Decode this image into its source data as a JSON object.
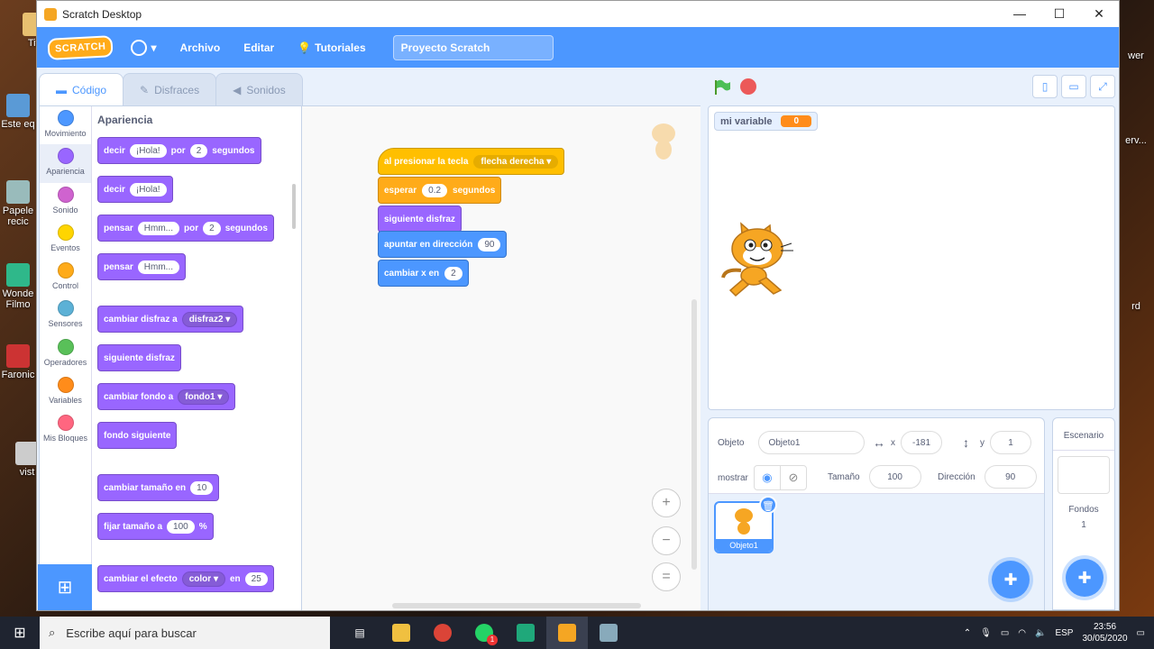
{
  "window": {
    "title": "Scratch Desktop"
  },
  "desktop_icons": [
    "Titi",
    "Este eq",
    "Papele recic",
    "Wonde Filmo",
    "Faronic",
    "vist",
    "wer",
    "erv...",
    "rd"
  ],
  "menu": {
    "logo": "SCRATCH",
    "items": [
      "Archivo",
      "Editar",
      "Tutoriales"
    ],
    "project_title": "Proyecto Scratch"
  },
  "tabs": [
    "Código",
    "Disfraces",
    "Sonidos"
  ],
  "categories": [
    {
      "label": "Movimiento",
      "color": "#4c97ff"
    },
    {
      "label": "Apariencia",
      "color": "#9966ff"
    },
    {
      "label": "Sonido",
      "color": "#cf63cf"
    },
    {
      "label": "Eventos",
      "color": "#ffd500"
    },
    {
      "label": "Control",
      "color": "#ffab19"
    },
    {
      "label": "Sensores",
      "color": "#5cb1d6"
    },
    {
      "label": "Operadores",
      "color": "#59c059"
    },
    {
      "label": "Variables",
      "color": "#ff8c1a"
    },
    {
      "label": "Mis Bloques",
      "color": "#ff6680"
    }
  ],
  "palette": {
    "section_title": "Apariencia",
    "say_secs": {
      "w1": "decir",
      "v1": "¡Hola!",
      "w2": "por",
      "v2": "2",
      "w3": "segundos"
    },
    "say": {
      "w1": "decir",
      "v1": "¡Hola!"
    },
    "think_secs": {
      "w1": "pensar",
      "v1": "Hmm...",
      "w2": "por",
      "v2": "2",
      "w3": "segundos"
    },
    "think": {
      "w1": "pensar",
      "v1": "Hmm..."
    },
    "switch_costume": {
      "w1": "cambiar disfraz a",
      "v1": "disfraz2"
    },
    "next_costume": "siguiente disfraz",
    "switch_backdrop": {
      "w1": "cambiar fondo a",
      "v1": "fondo1"
    },
    "next_backdrop": "fondo siguiente",
    "change_size": {
      "w1": "cambiar tamaño en",
      "v1": "10"
    },
    "set_size": {
      "w1": "fijar tamaño a",
      "v1": "100",
      "w2": "%"
    },
    "change_effect": {
      "w1": "cambiar el efecto",
      "v1": "color",
      "w2": "en",
      "v2": "25"
    }
  },
  "script": {
    "hat": {
      "w1": "al presionar la tecla",
      "v1": "flecha derecha"
    },
    "wait": {
      "w1": "esperar",
      "v1": "0.2",
      "w2": "segundos"
    },
    "next_costume": "siguiente disfraz",
    "point_dir": {
      "w1": "apuntar en dirección",
      "v1": "90"
    },
    "change_x": {
      "w1": "cambiar x en",
      "v1": "2"
    },
    "zoom_in": "+",
    "zoom_out": "−",
    "zoom_reset": "="
  },
  "stage": {
    "variable_name": "mi variable",
    "variable_value": "0"
  },
  "sprite_info": {
    "sprite_label": "Objeto",
    "sprite_name": "Objeto1",
    "x_label": "x",
    "x_value": "-181",
    "y_label": "y",
    "y_value": "1",
    "show_label": "mostrar",
    "size_label": "Tamaño",
    "size_value": "100",
    "direction_label": "Dirección",
    "direction_value": "90",
    "thumb_label": "Objeto1"
  },
  "stage_pane": {
    "title": "Escenario",
    "backdrops_label": "Fondos",
    "backdrops_count": "1"
  },
  "taskbar": {
    "search_placeholder": "Escribe aquí para buscar",
    "lang": "ESP",
    "time": "23:56",
    "date": "30/05/2020",
    "whatsapp_badge": "1"
  }
}
